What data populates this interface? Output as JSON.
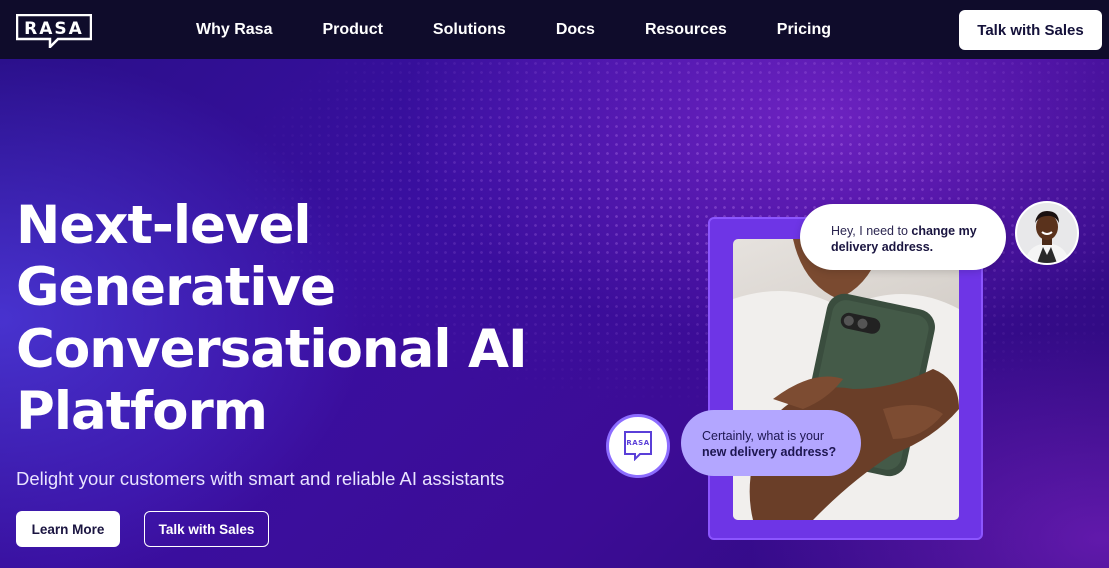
{
  "brand": {
    "logo_text": "RASA"
  },
  "nav": {
    "links": [
      "Why Rasa",
      "Product",
      "Solutions",
      "Docs",
      "Resources",
      "Pricing"
    ],
    "cta": "Talk with Sales"
  },
  "hero": {
    "headline_lines": [
      "Next-level",
      "Generative",
      "Conversational AI",
      "Platform"
    ],
    "subheading": "Delight your customers with smart and reliable AI assistants",
    "primary_button": "Learn More",
    "secondary_button": "Talk with Sales"
  },
  "chat": {
    "user_message_plain": "Hey, I need to ",
    "user_message_bold": "change my delivery address.",
    "bot_message_plain": "Certainly, what is your ",
    "bot_message_bold": "new delivery address?",
    "bot_logo_text": "RASA"
  },
  "colors": {
    "nav_bg": "#0f0c2b",
    "hero_purple": "#3a0fa0",
    "bot_bubble": "#b3a6ff",
    "accent": "#8c55ff"
  }
}
